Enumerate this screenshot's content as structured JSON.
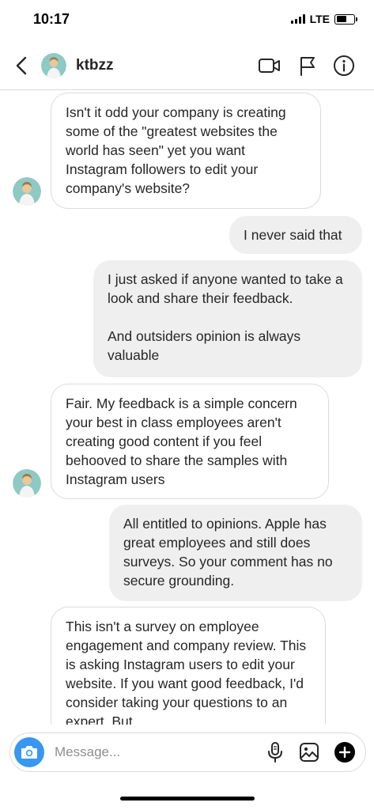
{
  "status_bar": {
    "time": "10:17",
    "network": "LTE"
  },
  "header": {
    "username": "ktbzz",
    "icons": [
      "back-icon",
      "video-camera-icon",
      "flag-icon",
      "info-icon"
    ]
  },
  "messages": [
    {
      "direction": "incoming",
      "text": "Isn't it odd your company is creating some of the \"greatest websites the world has seen\" yet you want Instagram followers to edit your company's website?"
    },
    {
      "direction": "outgoing",
      "text": "I never said that"
    },
    {
      "direction": "outgoing",
      "text": "I just asked if anyone wanted to take a look and share their feedback.\n\nAnd outsiders opinion is always valuable"
    },
    {
      "direction": "incoming",
      "text": "Fair. My feedback is a simple concern your best in class employees aren't creating good content if you feel behooved to share the samples with Instagram users"
    },
    {
      "direction": "outgoing",
      "text": "All entitled to opinions. Apple has great employees and still does surveys. So your comment has no secure grounding."
    },
    {
      "direction": "incoming",
      "text": "This isn't a survey on employee engagement and company review. This is asking Instagram users to edit your website. If you want good feedback, I'd consider taking your questions to an expert. But"
    }
  ],
  "composer": {
    "placeholder": "Message...",
    "icons": [
      "camera-icon",
      "microphone-icon",
      "gallery-icon",
      "add-icon"
    ]
  },
  "colors": {
    "accent": "#3897f0",
    "incoming_border": "#dbdbdb",
    "outgoing_bg": "#efefef"
  }
}
